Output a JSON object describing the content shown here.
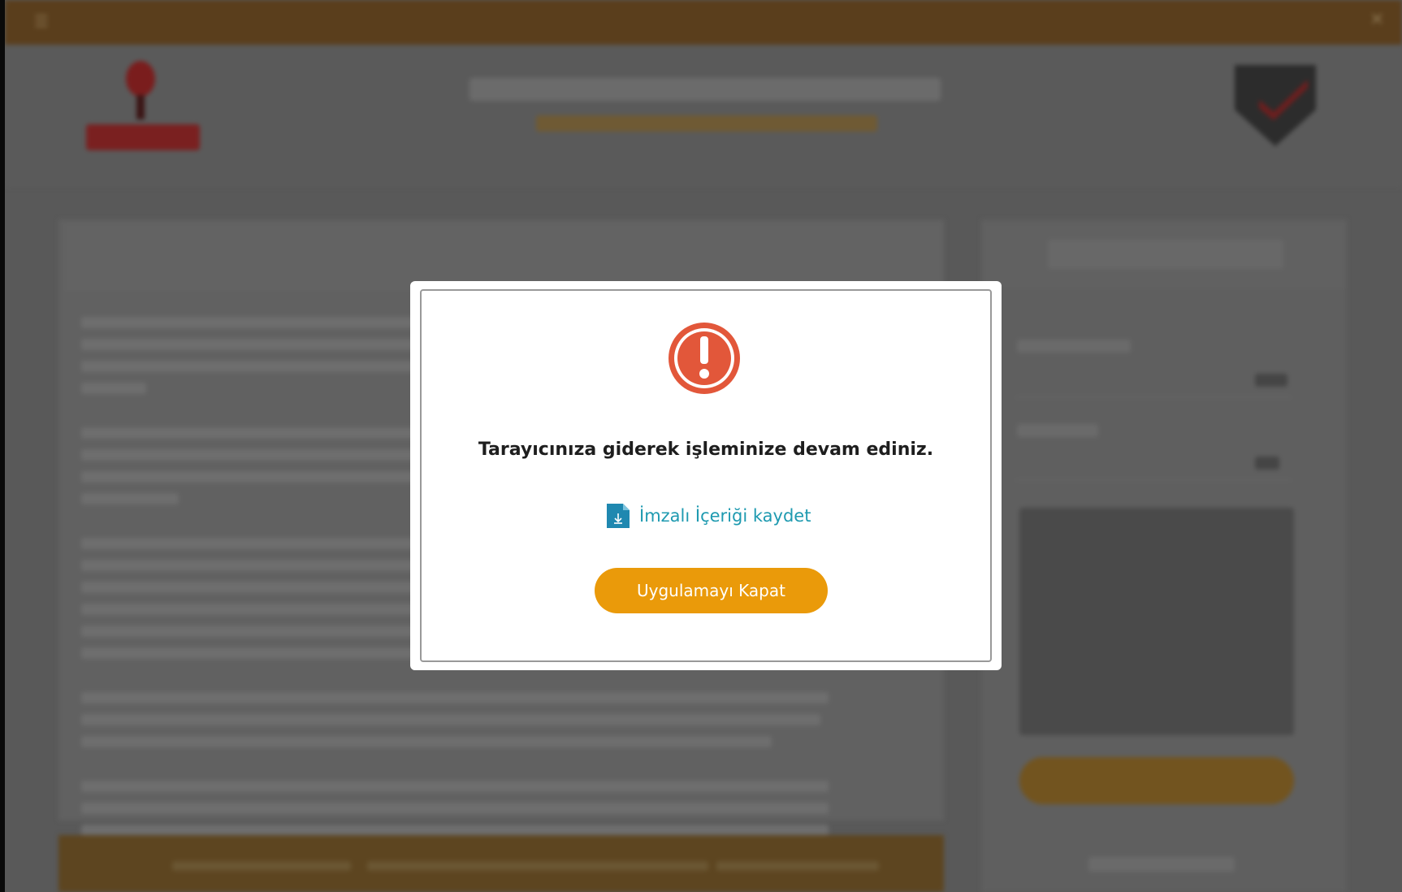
{
  "dialog": {
    "message": "Tarayıcınıza giderek işleminize devam ediniz.",
    "save_link_label": "İmzalı İçeriği kaydet",
    "close_button_label": "Uygulamayı Kapat",
    "alert_icon": "exclamation-circle-icon",
    "file_icon": "file-download-icon"
  },
  "colors": {
    "accent": "#ea9a0a",
    "link": "#1e9ab0",
    "alert": "#e2573a",
    "overlay": "#595959",
    "titlebar": "#5a3e1c"
  },
  "icons": {
    "titlebar_left": "menu-icon",
    "titlebar_right": "close-icon"
  }
}
